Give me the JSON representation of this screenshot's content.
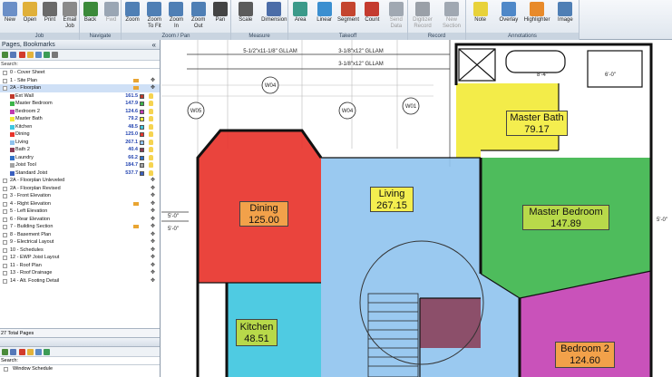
{
  "ribbon": {
    "groups": [
      {
        "label": "Job",
        "buttons": [
          {
            "label": "New"
          },
          {
            "label": "Open"
          },
          {
            "label": "Print"
          },
          {
            "label": "Email\nJob"
          }
        ]
      },
      {
        "label": "Navigate",
        "buttons": [
          {
            "label": "Back"
          },
          {
            "label": "Fwd"
          }
        ]
      },
      {
        "label": "Zoom / Pan",
        "buttons": [
          {
            "label": "Zoom"
          },
          {
            "label": "Zoom\nTo Fit"
          },
          {
            "label": "Zoom\nIn"
          },
          {
            "label": "Zoom\nOut"
          },
          {
            "label": "Pan"
          }
        ]
      },
      {
        "label": "Measure",
        "buttons": [
          {
            "label": "Scale"
          },
          {
            "label": "Dimension"
          }
        ]
      },
      {
        "label": "Takeoff",
        "buttons": [
          {
            "label": "Area"
          },
          {
            "label": "Linear"
          },
          {
            "label": "Segment"
          },
          {
            "label": "Count"
          },
          {
            "label": "Send\nData"
          }
        ]
      },
      {
        "label": "Record",
        "buttons": [
          {
            "label": "Digitizer\nRecord"
          },
          {
            "label": "New\nSection"
          }
        ]
      },
      {
        "label": "Annotations",
        "buttons": [
          {
            "label": "Note"
          },
          {
            "label": "Overlay"
          },
          {
            "label": "Highlighter"
          },
          {
            "label": "Image"
          }
        ]
      }
    ]
  },
  "sidebar": {
    "title": "Pages, Bookmarks",
    "search_label": "Search:",
    "pages": [
      {
        "name": "0 - Cover Sheet"
      },
      {
        "name": "1 - Site Plan"
      },
      {
        "name": "2A - Floorplan",
        "selected": true,
        "items": [
          {
            "name": "Ext Wall",
            "qty": "161.5",
            "color": "#c0392b"
          },
          {
            "name": "Master Bedroom",
            "qty": "147.9",
            "color": "#3bb54a"
          },
          {
            "name": "Bedroom 2",
            "qty": "124.6",
            "color": "#c13ab0"
          },
          {
            "name": "Master Bath",
            "qty": "79.2",
            "color": "#f2ea3a"
          },
          {
            "name": "Kitchen",
            "qty": "48.5",
            "color": "#40c7e0"
          },
          {
            "name": "Dining",
            "qty": "125.0",
            "color": "#e8342c"
          },
          {
            "name": "Living",
            "qty": "267.1",
            "color": "#8fc3ee"
          },
          {
            "name": "Bath 2",
            "qty": "40.4",
            "color": "#8a3a52"
          },
          {
            "name": "Laundry",
            "qty": "66.2",
            "color": "#2f6fc6"
          },
          {
            "name": "Joist Tool",
            "qty": "184.7",
            "color": "#a3a3a3"
          },
          {
            "name": "Standard Joist",
            "qty": "537.7",
            "color": "#3a5fbf"
          }
        ]
      },
      {
        "name": "2A - Floorplan Unleveled"
      },
      {
        "name": "2A - Floorplan Revised"
      },
      {
        "name": "3 - Front Elevation"
      },
      {
        "name": "4 - Right Elevation"
      },
      {
        "name": "5 - Left Elevation"
      },
      {
        "name": "6 - Rear Elevation"
      },
      {
        "name": "7 - Building Section"
      },
      {
        "name": "8 - Basement Plan"
      },
      {
        "name": "9 - Electrical Layout"
      },
      {
        "name": "10 - Schedules"
      },
      {
        "name": "12 - EWP Joist Layout"
      },
      {
        "name": "11 - Roof Plan"
      },
      {
        "name": "13 - Roof Drainage"
      },
      {
        "name": "14 - Alt. Footing Detail"
      }
    ],
    "total": "27 Total Pages",
    "bottom_search": "Search:",
    "bottom_item": "Window Schedule"
  },
  "rooms": [
    {
      "name": "Master Bath",
      "area": "79.17",
      "bg": "#f4ee4f"
    },
    {
      "name": "Living",
      "area": "267.15",
      "bg": "#f4ee4f"
    },
    {
      "name": "Dining",
      "area": "125.00",
      "bg": "#f2a14a"
    },
    {
      "name": "Master Bedroom",
      "area": "147.89",
      "bg": "#b8d94a"
    },
    {
      "name": "Kitchen",
      "area": "48.51",
      "bg": "#b8d94a"
    },
    {
      "name": "Bedroom 2",
      "area": "124.60",
      "bg": "#f2a14a"
    }
  ],
  "plan_text": {
    "beam1": "5-1/2\"x11-1/8\" GLLAM",
    "beam2": "3-1/8\"x12\" GLLAM",
    "beam3": "3-1/8\"x12\" GLLAM",
    "dim1": "5'-0\"",
    "dim2": "8'-4\"",
    "dim3": "6'-0\"",
    "dim4": "5'-0\"",
    "dim5": "5'-0\"",
    "tags": [
      "W05",
      "W04",
      "W04",
      "W01"
    ]
  }
}
